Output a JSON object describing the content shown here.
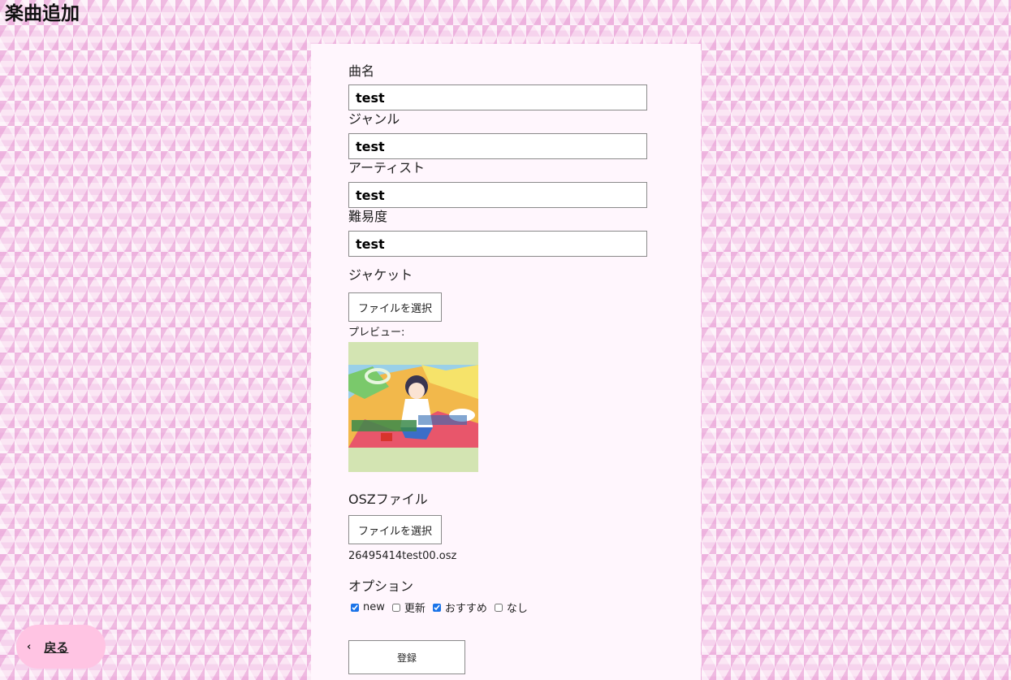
{
  "page": {
    "title": "楽曲追加"
  },
  "form": {
    "song_name": {
      "label": "曲名",
      "value": "test"
    },
    "genre": {
      "label": "ジャンル",
      "value": "test"
    },
    "artist": {
      "label": "アーティスト",
      "value": "test"
    },
    "difficulty": {
      "label": "難易度",
      "value": "test"
    },
    "jacket": {
      "label": "ジャケット",
      "button_label": "ファイルを選択",
      "preview_label": "プレビュー:"
    },
    "osz": {
      "label": "OSZファイル",
      "button_label": "ファイルを選択",
      "filename": "26495414test00.osz"
    },
    "options": {
      "label": "オプション",
      "items": [
        {
          "label": "new",
          "checked": true
        },
        {
          "label": "更新",
          "checked": false
        },
        {
          "label": "おすすめ",
          "checked": true
        },
        {
          "label": "なし",
          "checked": false
        }
      ]
    },
    "submit_label": "登録"
  },
  "nav": {
    "back_label": "戻る",
    "back_icon": "chevron-left-icon"
  },
  "colors": {
    "panel_background": "#fff6fd",
    "back_button": "#ffc4e3",
    "checkbox_accent": "#1a73e8"
  }
}
